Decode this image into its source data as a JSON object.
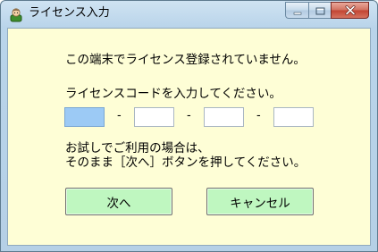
{
  "window": {
    "title": "ライセンス入力",
    "icon": "green-person-icon"
  },
  "caption_buttons": {
    "minimize_icon": "minimize-icon",
    "maximize_icon": "maximize-icon",
    "close_icon": "close-icon"
  },
  "message": {
    "not_registered": "この端末でライセンス登録されていません。",
    "enter_code": "ライセンスコードを入力してください。",
    "trial_line1": "お試しでご利用の場合は、",
    "trial_line2": "そのまま［次へ］ボタンを押してください。"
  },
  "license_code": {
    "fields": [
      "",
      "",
      "",
      ""
    ],
    "separator": "-"
  },
  "buttons": {
    "next": "次へ",
    "cancel": "キャンセル"
  },
  "colors": {
    "client_background": "#fefed6",
    "button_background": "#bff7c0",
    "focused_field": "#9ccaf5"
  }
}
